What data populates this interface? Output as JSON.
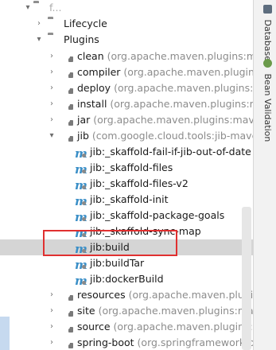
{
  "tree": {
    "top_project": {
      "label": "f...",
      "expanded": true
    },
    "lifecycle": {
      "label": "Lifecycle",
      "expanded": false
    },
    "plugins": {
      "label": "Plugins",
      "expanded": true
    },
    "plugin_items": [
      {
        "name": "clean",
        "group": "(org.apache.maven.plugins:maven"
      },
      {
        "name": "compiler",
        "group": "(org.apache.maven.plugins:ma"
      },
      {
        "name": "deploy",
        "group": "(org.apache.maven.plugins:mav"
      },
      {
        "name": "install",
        "group": "(org.apache.maven.plugins:mave"
      },
      {
        "name": "jar",
        "group": "(org.apache.maven.plugins:maven-ja"
      },
      {
        "name": "jib",
        "group": "(com.google.cloud.tools:jib-maven-p",
        "expanded": true
      }
    ],
    "jib_goals": [
      "jib:_skaffold-fail-if-jib-out-of-date",
      "jib:_skaffold-files",
      "jib:_skaffold-files-v2",
      "jib:_skaffold-init",
      "jib:_skaffold-package-goals",
      "jib:_skaffold-sync-map",
      "jib:build",
      "jib:buildTar",
      "jib:dockerBuild"
    ],
    "selected_goal": "jib:build",
    "more_plugins": [
      {
        "name": "resources",
        "group": "(org.apache.maven.plugins:mav"
      },
      {
        "name": "site",
        "group": "(org.apache.maven.plugins:maven-s"
      },
      {
        "name": "source",
        "group": "(org.apache.maven.plugins:mave"
      },
      {
        "name": "spring-boot",
        "group": "(org.springframework.boot:s"
      }
    ]
  },
  "side_tabs": [
    {
      "label": "Database",
      "icon": "database-icon"
    },
    {
      "label": "Bean Validation",
      "icon": "bean-validation-icon"
    }
  ],
  "colors": {
    "selection": "#d5d5d5",
    "highlight_border": "#e03030",
    "goal_icon": "#3b8fc7"
  }
}
